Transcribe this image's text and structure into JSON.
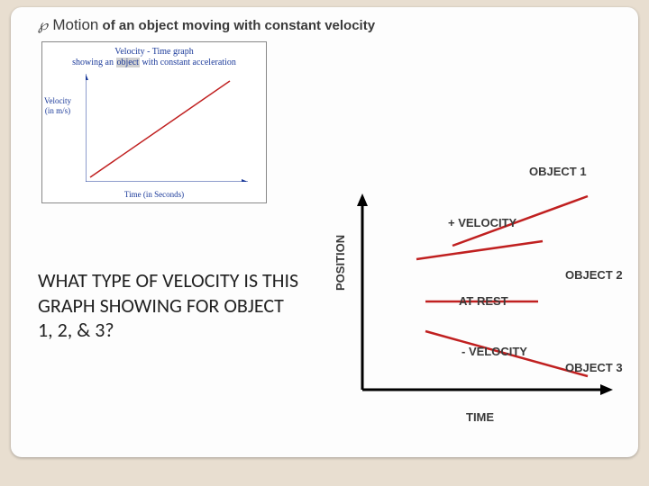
{
  "heading": {
    "bullet": "℘",
    "motion": "Motion",
    "rest": "of an object moving with constant velocity"
  },
  "thumb": {
    "title_line1": "Velocity - Time graph",
    "title_line2_a": "showing an ",
    "title_line2_b": "object",
    "title_line2_c": " with constant acceleration",
    "ylabel_line1": "Velocity",
    "ylabel_line2": "(in m/s)",
    "xlabel": "Time (in Seconds)"
  },
  "question": "WHAT TYPE OF VELOCITY IS THIS GRAPH SHOWING FOR OBJECT 1, 2, & 3?",
  "graph": {
    "object1": "OBJECT 1",
    "plus_velocity": "+ VELOCITY",
    "object2": "OBJECT 2",
    "at_rest": "AT REST",
    "minus_velocity": "- VELOCITY",
    "object3": "OBJECT 3",
    "ylabel": "POSITION",
    "xlabel": "TIME"
  },
  "chart_data": [
    {
      "type": "line",
      "title": "Velocity - Time graph showing an object with constant acceleration",
      "xlabel": "Time (in Seconds)",
      "ylabel": "Velocity (in m/s)",
      "xlim": [
        0,
        10
      ],
      "ylim": [
        0,
        10
      ],
      "series": [
        {
          "name": "velocity",
          "x": [
            0,
            10
          ],
          "y": [
            0,
            10
          ],
          "color": "#c02020"
        }
      ]
    },
    {
      "type": "line",
      "title": "Position vs Time for three objects",
      "xlabel": "TIME",
      "ylabel": "POSITION",
      "xlim": [
        0,
        10
      ],
      "ylim": [
        0,
        10
      ],
      "series": [
        {
          "name": "OBJECT 1 (+ VELOCITY)",
          "x": [
            0,
            10
          ],
          "y": [
            4,
            10
          ],
          "color": "#c02020"
        },
        {
          "name": "OBJECT 2 (AT REST)",
          "x": [
            0,
            10
          ],
          "y": [
            5,
            5
          ],
          "color": "#c02020"
        },
        {
          "name": "OBJECT 3 (- VELOCITY)",
          "x": [
            0,
            10
          ],
          "y": [
            3.5,
            0.5
          ],
          "color": "#c02020"
        }
      ]
    }
  ]
}
